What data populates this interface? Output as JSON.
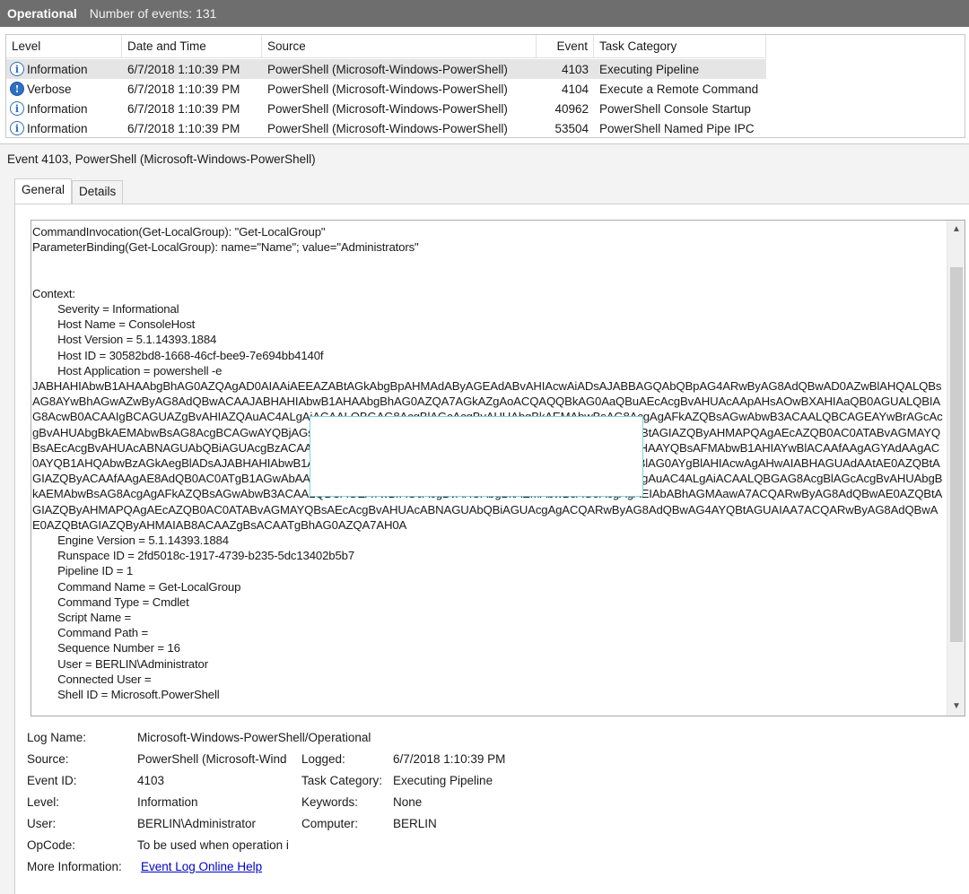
{
  "titlebar": {
    "log": "Operational",
    "count": "Number of events: 131"
  },
  "grid": {
    "headers": [
      "Level",
      "Date and Time",
      "Source",
      "Event ID",
      "Task Category"
    ],
    "rows": [
      {
        "level": "Information",
        "icon": "info-icon",
        "date": "6/7/2018 1:10:39 PM",
        "source": "PowerShell (Microsoft-Windows-PowerShell)",
        "id": "4103",
        "task": "Executing Pipeline"
      },
      {
        "level": "Verbose",
        "icon": "verbose-icon",
        "date": "6/7/2018 1:10:39 PM",
        "source": "PowerShell (Microsoft-Windows-PowerShell)",
        "id": "4104",
        "task": "Execute a Remote Command"
      },
      {
        "level": "Information",
        "icon": "info-icon",
        "date": "6/7/2018 1:10:39 PM",
        "source": "PowerShell (Microsoft-Windows-PowerShell)",
        "id": "40962",
        "task": "PowerShell Console Startup"
      },
      {
        "level": "Information",
        "icon": "info-icon",
        "date": "6/7/2018 1:10:39 PM",
        "source": "PowerShell (Microsoft-Windows-PowerShell)",
        "id": "53504",
        "task": "PowerShell Named Pipe IPC"
      }
    ]
  },
  "detail": {
    "title": "Event 4103, PowerShell (Microsoft-Windows-PowerShell)",
    "tabs": [
      "General",
      "Details"
    ],
    "text": "CommandInvocation(Get-LocalGroup): \"Get-LocalGroup\"\nParameterBinding(Get-LocalGroup): name=\"Name\"; value=\"Administrators\"\n\n\nContext:\n        Severity = Informational\n        Host Name = ConsoleHost\n        Host Version = 5.1.14393.1884\n        Host ID = 30582bd8-1668-46cf-bee9-7e694bb4140f\n        Host Application = powershell -e\nJABHAHIAbwB1AHAAbgBhAG0AZQAgAD0AIAAiAEEAZABtAGkAbgBpAHMAdAByAGEAdABvAHIAcwAiADsAJABBAGQAbQBpAG4ARwByAG8AdQBwAD0AZwBlAHQALQBsAG8AYwBhAGwAZwByAG8AdQBwACAAJABHAHIAbwB1AHAAbgBhAG0AZQA7AGkAZgAoACQAQQBkAG0AaQBuAEcAcgBvAHUAcAApAHsAOwBXAHIAaQB0AGUALQBIAG8AcwB0ACAAIgBCAGUAZgBvAHIAZQAuAC4ALgAiACAALQBGAG8AcgBlAGcAcgBvAHUAbgBkAEMAbwBsAG8AcgAgAFkAZQBsAGwAbwB3ACAALQBCAGEAYwBrAGcAcgBvAHUAbgBkAEMAbwBsAG8AcgBCAGwAYQBjAGsAOwAkAGcAcgBvAHUAcAA7ACQARwByAG8AdQBwAE0AZQBtAGIAZQByAHMAPQAgAEcAZQB0AC0ATABvAGMAYQBsAEcAcgBvAHUAcABNAGUAbQBiAGUAcgBzACAAfAAgAGYAbAAgAE4AYQBtAGUALAAgAFAAcgBpAG4AYwBpAHAAYQBsAFMAbwB1AHIAYwBlACAAfAAgAGYAdAAgAC0AYQB1AHQAbwBzAGkAegBlADsAJABHAHIAbwB1AHAATQBlAG0AYgBlAHIAcwA7AH0AJABHAHIAbwB1AHAATQBlAG0AYgBlAHIAcwAgAHwAIABHAGUAdAAtAE0AZQBtAGIAZQByACAAfAAgAE8AdQB0AC0ATgB1AGwAbAA7AFcAcgBpAHQAZQAtAEgAbwBzAHQAIAAiAEEAZgB0AGUAcgAuAC4ALgAiACAALQBGAG8AcgBlAGcAcgBvAHUAbgBkAEMAbwBsAG8AcgAgAFkAZQBsAGwAbwB3ACAALQBCAGEAYwBrAGcAcgBvAHUAbgBkAEMAbwBsAG8AcgAgAEIAbABhAGMAawA7ACQARwByAG8AdQBwAE0AZQBtAGIAZQByAHMAPQAgAEcAZQB0AC0ATABvAGMAYQBsAEcAcgBvAHUAcABNAGUAbQBiAGUAcgAgACQARwByAG8AdQBwAG4AYQBtAGUAIAA7ACQARwByAG8AdQBwAE0AZQBtAGIAZQByAHMAIAB8ACAAZgBsACAATgBhAG0AZQA7AH0A\n        Engine Version = 5.1.14393.1884\n        Runspace ID = 2fd5018c-1917-4739-b235-5dc13402b5b7\n        Pipeline ID = 1\n        Command Name = Get-LocalGroup\n        Command Type = Cmdlet\n        Script Name =\n        Command Path =\n        Sequence Number = 16\n        User = BERLIN\\Administrator\n        Connected User =\n        Shell ID = Microsoft.PowerShell"
  },
  "props": {
    "log_name_label": "Log Name:",
    "log_name": "Microsoft-Windows-PowerShell/Operational",
    "source_label": "Source:",
    "source": "PowerShell (Microsoft-Wind",
    "logged_label": "Logged:",
    "logged": "6/7/2018 1:10:39 PM",
    "event_id_label": "Event ID:",
    "event_id": "4103",
    "task_label": "Task Category:",
    "task": "Executing Pipeline",
    "level_label": "Level:",
    "level": "Information",
    "keywords_label": "Keywords:",
    "keywords": "None",
    "user_label": "User:",
    "user": "BERLIN\\Administrator",
    "computer_label": "Computer:",
    "computer": "BERLIN",
    "opcode_label": "OpCode:",
    "opcode": "To be used when operation i",
    "more_label": "More Information:",
    "more_link": "Event Log Online Help"
  }
}
